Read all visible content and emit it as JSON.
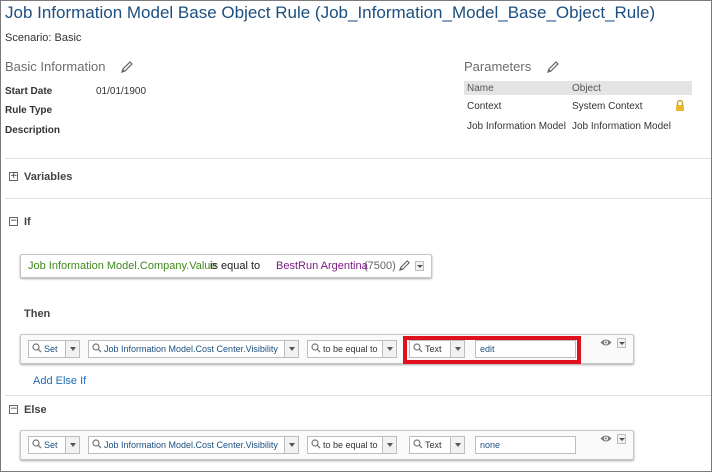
{
  "header": {
    "title": "Job Information Model Base Object Rule (Job_Information_Model_Base_Object_Rule)",
    "scenario": "Scenario: Basic"
  },
  "basic_info": {
    "heading": "Basic Information",
    "start_date_label": "Start Date",
    "start_date_value": "01/01/1900",
    "rule_type_label": "Rule Type",
    "description_label": "Description"
  },
  "parameters": {
    "heading": "Parameters",
    "columns": [
      "Name",
      "Object"
    ],
    "rows": [
      {
        "name": "Context",
        "object": "System Context"
      },
      {
        "name": "Job Information Model",
        "object": "Job Information Model"
      }
    ]
  },
  "variables": {
    "label": "Variables",
    "toggle": "+"
  },
  "if_section": {
    "label": "If",
    "toggle": "−",
    "condition": {
      "field": "Job Information Model.Company.Value",
      "operator": "is equal to",
      "value": "BestRun Argentina",
      "value_code": "(7500)"
    }
  },
  "then_section": {
    "label": "Then",
    "action": "Set",
    "target": "Job Information Model.Cost Center.Visibility",
    "operator": "to be equal to",
    "type": "Text",
    "value": "edit"
  },
  "add_else_if": "Add Else If",
  "else_section": {
    "label": "Else",
    "toggle": "−",
    "action": "Set",
    "target": "Job Information Model.Cost Center.Visibility",
    "operator": "to be equal to",
    "type": "Text",
    "value": "none"
  },
  "colors": {
    "title": "#1c4f80",
    "field_green": "#3f8a1c",
    "value_purple": "#7c1c86",
    "highlight_red": "#e0101c",
    "link_blue": "#1e6db5"
  },
  "icons": [
    "pencil-icon",
    "lock-icon",
    "search-icon",
    "eye-icon",
    "chevron-down-icon"
  ]
}
